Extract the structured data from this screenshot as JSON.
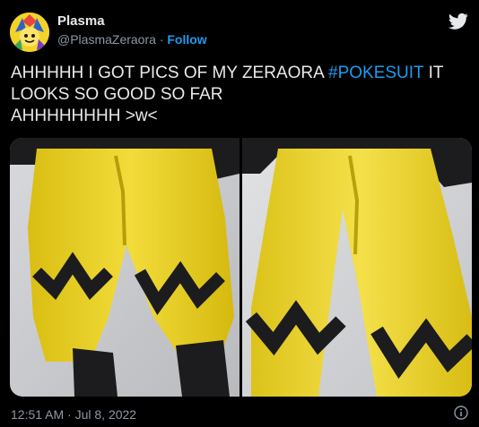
{
  "user": {
    "display_name": "Plasma",
    "handle": "@PlasmaZeraora",
    "separator": "·",
    "follow_label": "Follow"
  },
  "tweet": {
    "text_before": "AHHHHH I GOT PICS OF MY ZERAORA ",
    "hashtag": "#POKESUIT",
    "text_after": " IT LOOKS SO GOOD SO FAR",
    "text_line3": "AHHHHHHHH >w<"
  },
  "media": {
    "photos": [
      {
        "alt": "Yellow Zeraora suit pants with black zigzag stripes, front view"
      },
      {
        "alt": "Yellow Zeraora suit pants with black zigzag stripes, close view"
      }
    ]
  },
  "footer": {
    "timestamp": "12:51 AM · Jul 8, 2022"
  },
  "icons": {
    "bird": "twitter-bird-icon",
    "info": "info-icon"
  },
  "colors": {
    "background": "#000000",
    "text": "#e7e9ea",
    "secondary": "#8b98a5",
    "link": "#1d9bf0",
    "suit_yellow": "#f0d62b",
    "suit_black": "#1c1c1e"
  }
}
